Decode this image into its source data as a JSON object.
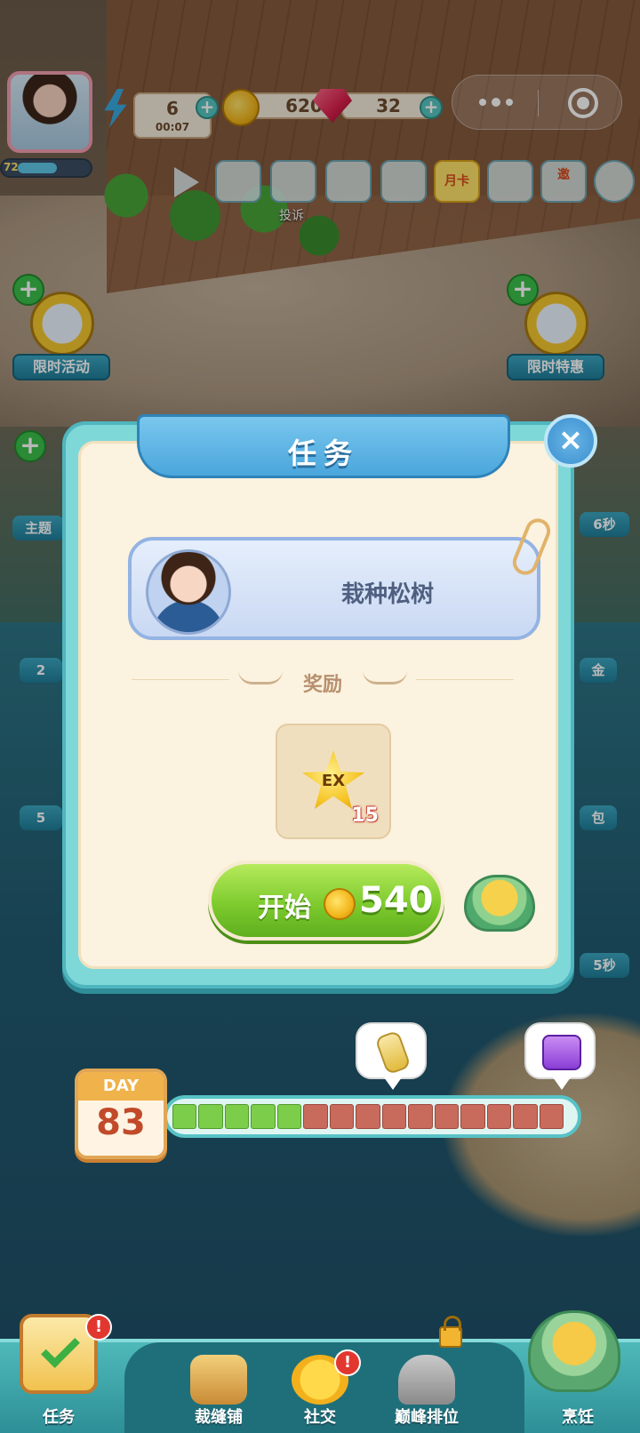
{
  "hud": {
    "level": "72",
    "energy": "6",
    "energy_timer": "00:07",
    "coins": "620",
    "gems": "32",
    "plus": "+",
    "report_label": "投诉",
    "month_card_label": "月卡",
    "invite_label": "邀",
    "icons": [
      "play-icon",
      "camera-icon",
      "report-icon",
      "friends-icon",
      "book-icon",
      "month-card-icon",
      "calendar-check-icon",
      "invite-mail-icon",
      "gear-icon"
    ]
  },
  "side_buttons": {
    "left_event": "限时活动",
    "right_sale": "限时特惠",
    "left_partial_1": "主题",
    "left_partial_2": "2",
    "left_partial_3": "5",
    "right_partial_1": "6秒",
    "right_partial_2": "金",
    "right_partial_3": "包",
    "right_partial_4": "5秒"
  },
  "dialog": {
    "title": "任务",
    "close": "×",
    "task_name": "栽种松树",
    "reward_label": "奖励",
    "reward_item": "EX",
    "reward_qty": "15",
    "start_label": "开始",
    "start_cost": "540"
  },
  "progress": {
    "day_label": "DAY",
    "day_number": "83",
    "total_cells": 15,
    "completed_cells": 5,
    "colors": {
      "done": "#7ccd4a",
      "pending": "#c86a5c"
    }
  },
  "bottom_nav": {
    "items": [
      {
        "label": "任务",
        "icon": "task-checklist-icon",
        "badge": "!"
      },
      {
        "label": "裁缝铺",
        "icon": "tailor-icon"
      },
      {
        "label": "社交",
        "icon": "social-chat-icon",
        "badge": "!"
      },
      {
        "label": "巅峰排位",
        "icon": "trophy-icon",
        "locked": true
      },
      {
        "label": "烹饪",
        "icon": "cooking-pot-icon"
      }
    ]
  }
}
